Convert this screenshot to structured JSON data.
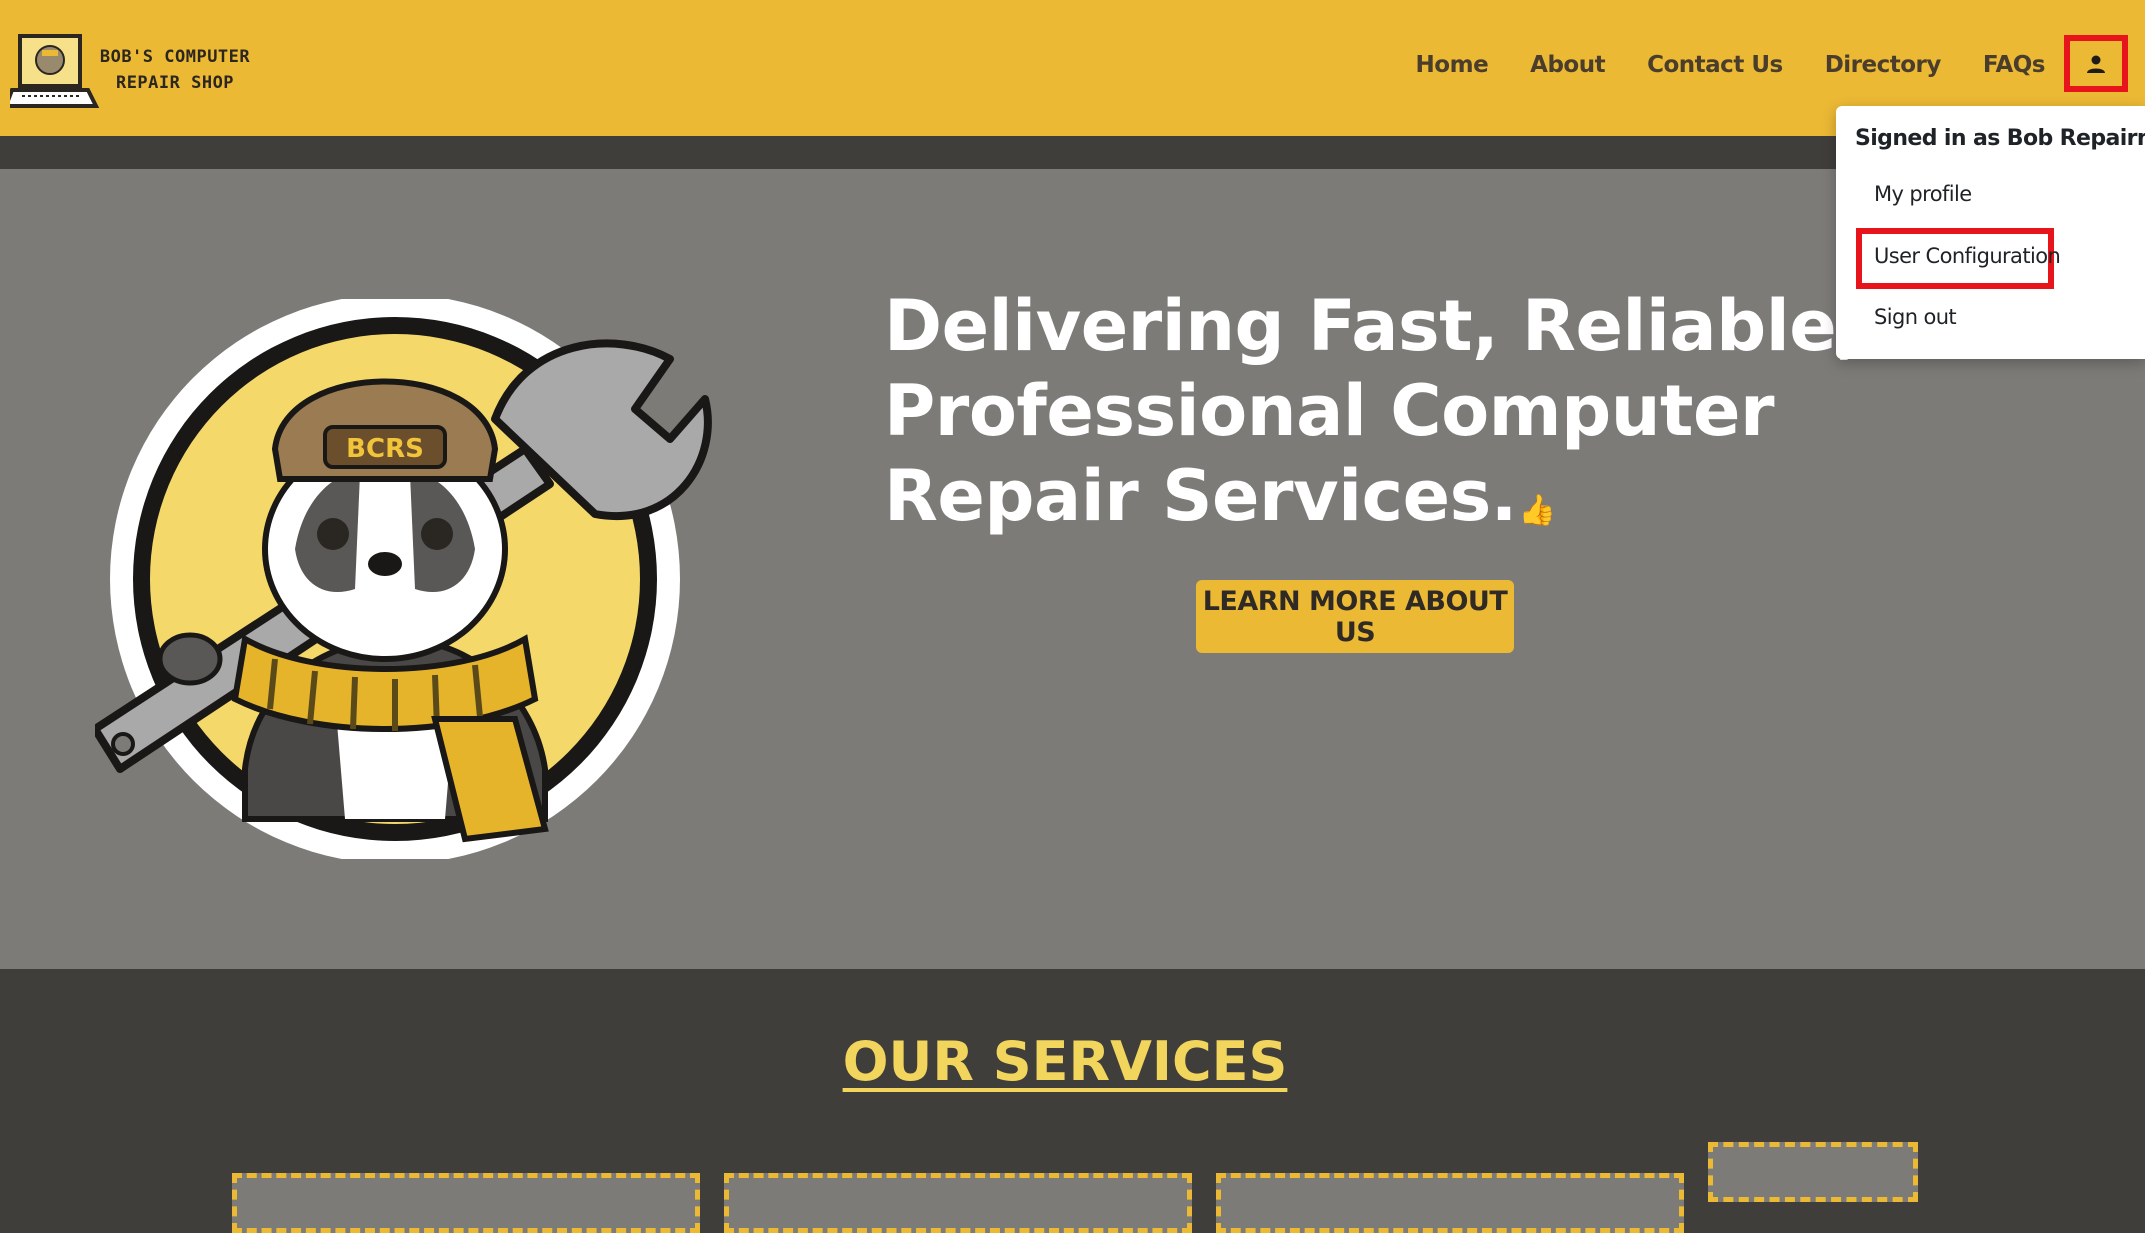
{
  "brand": {
    "logo_line1": "BOB'S COMPUTER",
    "logo_line2": "REPAIR SHOP"
  },
  "nav": {
    "items": [
      "Home",
      "About",
      "Contact Us",
      "Directory",
      "FAQs"
    ]
  },
  "user_menu": {
    "signed_in_text": "Signed in as Bob Repairman",
    "items": [
      "My profile",
      "User Configuration",
      "Sign out"
    ]
  },
  "hero": {
    "title": "Delivering Fast, Reliable, and Professional Computer Repair Services.",
    "cta_label": "LEARN MORE ABOUT US",
    "mascot_cap_text": "BCRS"
  },
  "services": {
    "title": "OUR SERVICES"
  },
  "colors": {
    "header_bg": "#ecb935",
    "hero_bg": "#7d7b78",
    "page_bg": "#403e3b",
    "accent_yellow": "#f2d55c",
    "highlight_red": "#e8141c"
  },
  "icons": {
    "user": "person-icon",
    "thumb": "thumbs-up-icon"
  }
}
